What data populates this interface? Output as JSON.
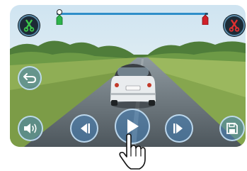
{
  "trim_range": {
    "start": 0.02,
    "end": 0.98
  },
  "icons": {
    "trim_start": "scissors-icon",
    "trim_end": "scissors-icon",
    "back": "undo-arrow-icon",
    "volume": "speaker-icon",
    "prev": "step-back-icon",
    "play": "play-icon",
    "next": "step-forward-icon",
    "save": "floppy-disk-icon",
    "cursor": "hand-pointer-icon"
  },
  "colors": {
    "start_handle": "#2db34a",
    "end_handle": "#d0202a",
    "scissors_green": "#3cc44a",
    "scissors_red": "#e03030",
    "accent_blue": "#3f83c0"
  }
}
